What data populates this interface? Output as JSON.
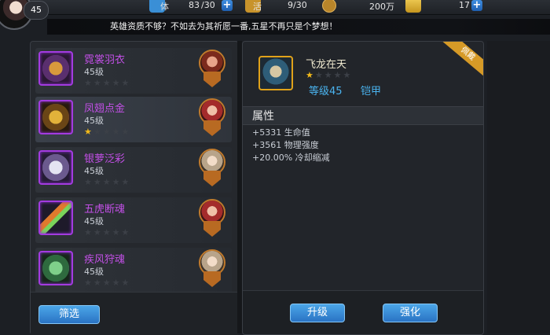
{
  "player": {
    "level": "45"
  },
  "resources": {
    "stamina": {
      "label": "体",
      "current": "83",
      "max": "/30"
    },
    "vitality": {
      "label": "活",
      "value": "9/30"
    },
    "gold": {
      "value": "200万"
    },
    "ingot": {
      "value": "17"
    }
  },
  "tip": "英雄资质不够？不如去为其祈愿一番,五星不再只是个梦想！",
  "items": [
    {
      "name": "霓裳羽衣",
      "level": "45级",
      "stars": 0,
      "icon_color": "#c9882f"
    },
    {
      "name": "凤翅点金",
      "level": "45级",
      "stars": 1,
      "icon_color": "#c9a02a"
    },
    {
      "name": "银萝泛彩",
      "level": "45级",
      "stars": 0,
      "icon_color": "#bcbcd8"
    },
    {
      "name": "五虎断魂",
      "level": "45级",
      "stars": 0,
      "icon_color": "#d0672a"
    },
    {
      "name": "疾风狩魂",
      "level": "45级",
      "stars": 0,
      "icon_color": "#4fa56a"
    }
  ],
  "buttons": {
    "filter": "筛选",
    "upgrade": "升级",
    "enhance": "强化"
  },
  "detail": {
    "name": "飞龙在天",
    "stars": 1,
    "level": "等级45",
    "type": "铠甲",
    "badge": "佩戴",
    "attr_title": "属性",
    "attrs": [
      "+5331 生命值",
      "+3561 物理强度",
      "+20.00% 冷却缩减"
    ]
  }
}
